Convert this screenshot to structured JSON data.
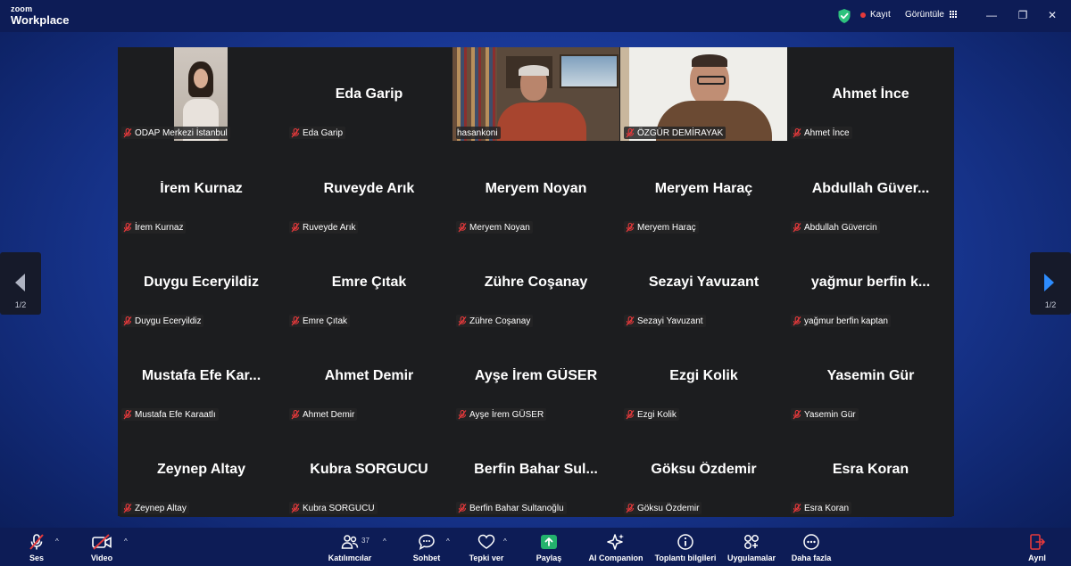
{
  "app": {
    "logo_small": "zoom",
    "logo_big": "Workplace"
  },
  "titlebar": {
    "record_label": "Kayıt",
    "view_label": "Görüntüle",
    "minimize": "—",
    "restore": "❐",
    "close": "✕"
  },
  "colors": {
    "accent_green": "#2ec27e",
    "record_red": "#e5393b",
    "share_green": "#23b26d",
    "mute_red": "#e5393b",
    "arrow_blue": "#2d8cff"
  },
  "pagination": {
    "left_page": "1/2",
    "right_page": "1/2"
  },
  "tiles": [
    {
      "display": "",
      "label": "ODAP Merkezi İstanbul",
      "video": true
    },
    {
      "display": "Eda Garip",
      "label": "Eda Garip"
    },
    {
      "display": "",
      "label": "hasankoni",
      "video": true,
      "speaking": true
    },
    {
      "display": "",
      "label": "ÖZGÜR DEMİRAYAK",
      "video": true
    },
    {
      "display": "Ahmet İnce",
      "label": "Ahmet İnce"
    },
    {
      "display": "İrem Kurnaz",
      "label": "İrem Kurnaz"
    },
    {
      "display": "Ruveyde Arık",
      "label": "Ruveyde Arık"
    },
    {
      "display": "Meryem Noyan",
      "label": "Meryem Noyan"
    },
    {
      "display": "Meryem Haraç",
      "label": "Meryem Haraç"
    },
    {
      "display": "Abdullah Güver...",
      "label": "Abdullah Güvercin"
    },
    {
      "display": "Duygu Eceryildiz",
      "label": "Duygu Eceryildiz"
    },
    {
      "display": "Emre Çıtak",
      "label": "Emre Çıtak"
    },
    {
      "display": "Zühre Coşanay",
      "label": "Zühre Coşanay"
    },
    {
      "display": "Sezayi Yavuzant",
      "label": "Sezayi Yavuzant"
    },
    {
      "display": "yağmur berfin k...",
      "label": "yağmur berfin kaptan"
    },
    {
      "display": "Mustafa Efe Kar...",
      "label": "Mustafa Efe Karaatlı"
    },
    {
      "display": "Ahmet Demir",
      "label": "Ahmet Demir"
    },
    {
      "display": "Ayşe İrem GÜSER",
      "label": "Ayşe İrem GÜSER"
    },
    {
      "display": "Ezgi Kolik",
      "label": "Ezgi Kolik"
    },
    {
      "display": "Yasemin Gür",
      "label": "Yasemin Gür"
    },
    {
      "display": "Zeynep Altay",
      "label": "Zeynep Altay"
    },
    {
      "display": "Kubra SORGUCU",
      "label": "Kubra SORGUCU"
    },
    {
      "display": "Berfin Bahar Sul...",
      "label": "Berfin Bahar Sultanoğlu"
    },
    {
      "display": "Göksu Özdemir",
      "label": "Göksu Özdemir"
    },
    {
      "display": "Esra Koran",
      "label": "Esra Koran"
    }
  ],
  "toolbar": {
    "audio": "Ses",
    "video": "Video",
    "participants": "Katılımcılar",
    "participants_count": "37",
    "chat": "Sohbet",
    "react": "Tepki ver",
    "share": "Paylaş",
    "ai": "AI Companion",
    "info": "Toplantı bilgileri",
    "apps": "Uygulamalar",
    "more": "Daha fazla",
    "leave": "Ayrıl"
  },
  "icons": {
    "shield": "shield-check-icon",
    "record": "record-dot-icon",
    "view": "grid-icon",
    "mic": "mic-muted-icon",
    "camera": "camera-off-icon",
    "participants": "people-icon",
    "chat": "chat-icon",
    "react": "heart-icon",
    "share": "share-arrow-icon",
    "ai": "sparkle-icon",
    "info": "info-icon",
    "apps": "apps-icon",
    "more": "more-icon",
    "leave": "leave-icon"
  }
}
